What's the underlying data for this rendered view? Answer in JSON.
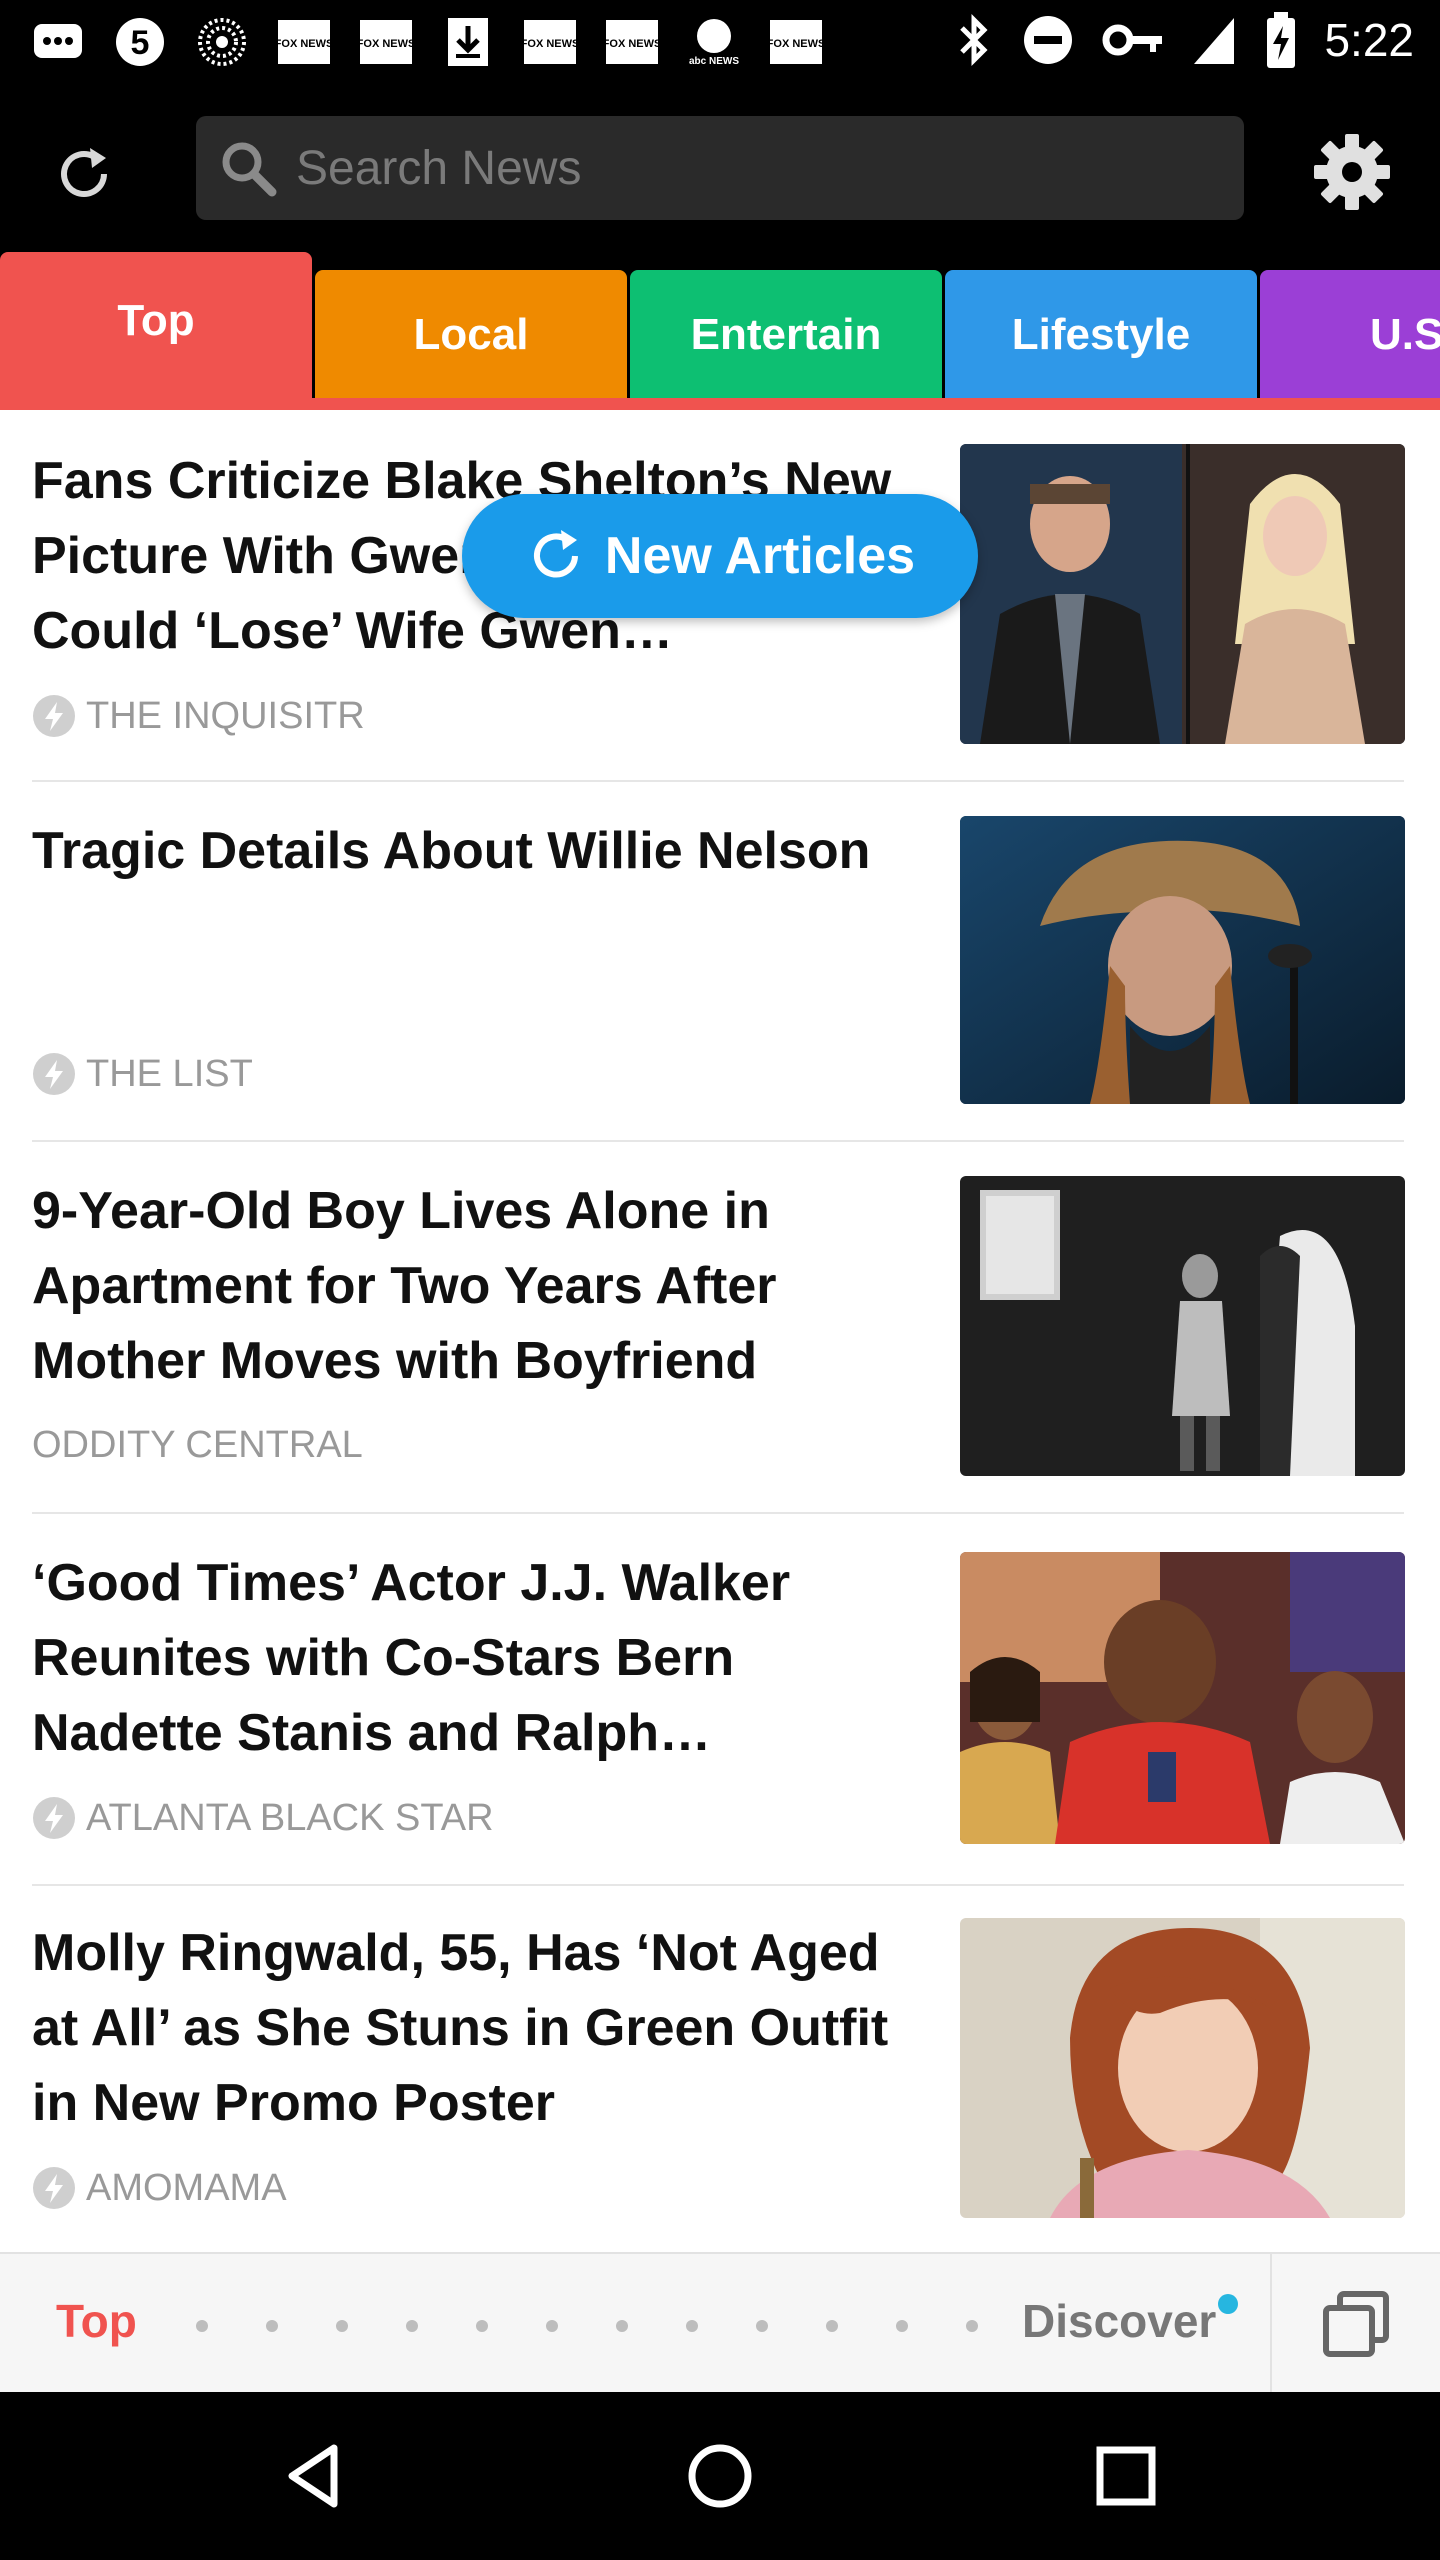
{
  "status_bar": {
    "time": "5:22",
    "left_icons": [
      "chat-icon",
      "five-circle-icon",
      "sunburst-icon",
      "fox-news-icon",
      "fox-news-icon",
      "download-icon",
      "fox-news-icon",
      "fox-news-icon",
      "abc-news-icon",
      "fox-news-icon"
    ],
    "left_icon_labels": [
      "",
      "5",
      "",
      "FOX NEWS",
      "FOX NEWS",
      "",
      "FOX NEWS",
      "FOX NEWS",
      "abc NEWS",
      "FOX NEWS"
    ],
    "right_icons": [
      "bluetooth-icon",
      "do-not-disturb-icon",
      "key-icon",
      "signal-icon",
      "battery-icon"
    ]
  },
  "header": {
    "search_placeholder": "Search News"
  },
  "tabs": [
    {
      "label": "Top",
      "color": "#f0534f",
      "active": true
    },
    {
      "label": "Local",
      "color": "#ef8a00",
      "active": false
    },
    {
      "label": "Entertain",
      "color": "#0dbf72",
      "active": false
    },
    {
      "label": "Lifestyle",
      "color": "#2f98e8",
      "active": false
    },
    {
      "label": "U.S",
      "color": "#9b3fd6",
      "active": false
    }
  ],
  "new_articles_label": "New Articles",
  "articles": [
    {
      "title": "Fans Criticize Blake Shelton’s New Picture With Gwen Stefani, Say He Could ‘Lose’ Wife Gwen…",
      "source": "THE INQUISITR",
      "has_bolt": true,
      "thumb": "Blake Shelton and Gwen Stefani"
    },
    {
      "title": "Tragic Details About Willie Nelson",
      "source": "THE LIST",
      "has_bolt": true,
      "thumb": "Willie Nelson"
    },
    {
      "title": "9-Year-Old Boy Lives Alone in Apartment for Two Years After Mother Moves with Boyfriend",
      "source": "ODDITY CENTRAL",
      "has_bolt": false,
      "thumb": "Boy in dark room"
    },
    {
      "title": "‘Good Times’ Actor J.J. Walker Reunites with Co-Stars Bern Nadette Stanis and Ralph…",
      "source": "ATLANTA BLACK STAR",
      "has_bolt": true,
      "thumb": "J.J. Walker with co-stars"
    },
    {
      "title": "Molly Ringwald, 55, Has ‘Not Aged at All’ as She Stuns in Green Outfit in New Promo Poster",
      "source": "AMOMAMA",
      "has_bolt": true,
      "thumb": "Molly Ringwald"
    }
  ],
  "bottom_bar": {
    "top_label": "Top",
    "discover_label": "Discover",
    "dot_count": 12
  },
  "nav_bar": {
    "buttons": [
      "back-icon",
      "home-icon",
      "recents-icon"
    ]
  }
}
